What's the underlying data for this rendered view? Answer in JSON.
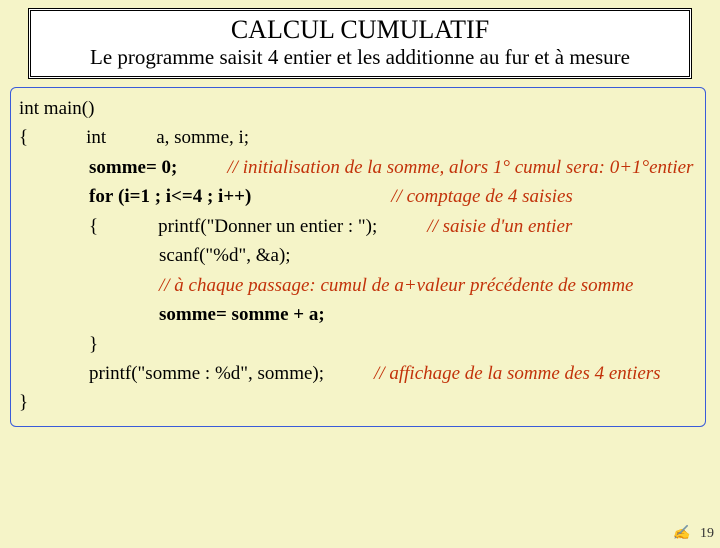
{
  "title": {
    "main": "CALCUL CUMULATIF",
    "sub": "Le programme saisit 4 entier et les additionne au fur et à mesure"
  },
  "code": {
    "l1": "int main()",
    "l2_open": "{",
    "l2_int": "int",
    "l2_decl": "a, somme, i;",
    "l3_stmt": "somme= 0;",
    "l3_comment": "// initialisation de la somme, alors 1° cumul sera: 0+1°entier",
    "l4_for_kw": "for",
    "l4_for_rest": " (i=1 ; i<=4 ; i++)",
    "l4_comment": "// comptage de 4 saisies",
    "l5_open": "{",
    "l5_printf": "printf(\"Donner un entier : \");",
    "l5_comment": "// saisie d'un entier",
    "l6_scanf": "scanf(\"%d\", &a);",
    "l7_comment": "// à chaque passage: cumul de a+valeur précédente de somme",
    "l8_stmt": "somme= somme + a;",
    "l9_close": "}",
    "l10_printf": "printf(\"somme : %d\", somme);",
    "l10_comment": "// affichage de la somme des 4 entiers",
    "l11_close": "}"
  },
  "page": "19",
  "deco": "✍"
}
